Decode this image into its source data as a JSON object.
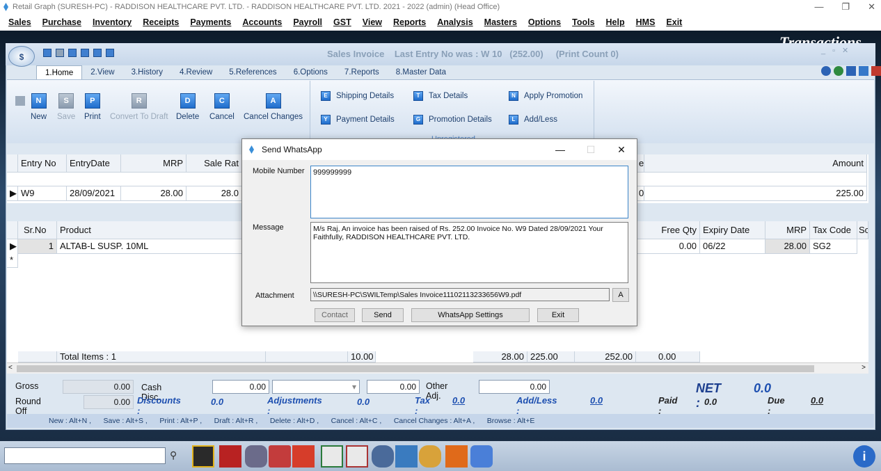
{
  "titlebar": {
    "text": "Retail Graph (SURESH-PC) - RADDISON HEALTHCARE PVT. LTD. - RADDISON HEALTHCARE PVT. LTD. 2021 - 2022 (admin) (Head Office)"
  },
  "menu": [
    "Sales",
    "Purchase",
    "Inventory",
    "Receipts",
    "Payments",
    "Accounts",
    "Payroll",
    "GST",
    "View",
    "Reports",
    "Analysis",
    "Masters",
    "Options",
    "Tools",
    "Help",
    "HMS",
    "Exit"
  ],
  "background": {
    "banner": "Transactions"
  },
  "form": {
    "title": "Sales Invoice    Last Entry No was : W 10   (252.00)     (Print Count 0)",
    "tabs": [
      "1.Home",
      "2.View",
      "3.History",
      "4.Review",
      "5.References",
      "6.Options",
      "7.Reports",
      "8.Master Data"
    ],
    "buttons": {
      "new": "New",
      "save": "Save",
      "print": "Print",
      "draft": "Convert To Draft",
      "delete": "Delete",
      "cancel": "Cancel",
      "cancel_changes": "Cancel Changes"
    },
    "side_buttons": {
      "shipping": "Shipping Details",
      "payment": "Payment Details",
      "tax": "Tax Details",
      "promotion": "Promotion Details",
      "apply_promo": "Apply Promotion",
      "addless": "Add/Less"
    },
    "unregistered": "Unregistered",
    "header_grid": {
      "columns": [
        "Entry No",
        "EntryDate",
        "MRP",
        "Sale Rat",
        "e",
        "Amount"
      ],
      "row": [
        "W9",
        "28/09/2021",
        "28.00",
        "28.0",
        "0",
        "225.00"
      ]
    },
    "items_grid": {
      "columns": [
        "Sr.No",
        "Product",
        "Free Qty",
        "Expiry Date",
        "MRP",
        "Tax Code",
        "Sc"
      ],
      "row": [
        "1",
        "ALTAB-L SUSP. 10ML",
        "0.00",
        "06/22",
        "28.00",
        "SG2"
      ],
      "new_row_marker": "*",
      "totals": {
        "label": "Total Items : 1",
        "qty": "10.00",
        "rate": "28.00",
        "amount": "225.00",
        "net": "252.00",
        "free": "0.00"
      }
    },
    "summary": {
      "gross_label": "Gross",
      "gross": "0.00",
      "cash_disc_label": "Cash Disc.",
      "cash_disc": "0.00",
      "disc_pct": "0.00",
      "other_adj_label": "Other Adj.",
      "other_adj": "0.00",
      "net_label": "NET :",
      "net": "0.0",
      "roundoff_label": "Round Off",
      "roundoff": "0.00",
      "discounts_label": "Discounts :",
      "discounts": "0.0",
      "adjustments_label": "Adjustments :",
      "adjustments": "0.0",
      "tax_label": "Tax :",
      "tax": "0.0",
      "addless_label": "Add/Less :",
      "addless": "0.0",
      "paid_label": "Paid :",
      "paid": "0.0",
      "due_label": "Due :",
      "due": "0.0"
    },
    "shortcuts": "New : Alt+N ,      Save : Alt+S ,      Print : Alt+P ,      Draft : Alt+R ,      Delete : Alt+D ,      Cancel : Alt+C ,      Cancel Changes : Alt+A ,      Browse : Alt+E"
  },
  "dialog": {
    "title": "Send WhatsApp",
    "mobile_label": "Mobile Number",
    "mobile": "999999999",
    "message_label": "Message",
    "message": "M/s Raj, An invoice has been raised of Rs. 252.00 Invoice No. W9 Dated 28/09/2021 Your Faithfully, RADDISON HEALTHCARE PVT. LTD.",
    "attachment_label": "Attachment",
    "attachment": "\\\\SURESH-PC\\SWILTemp\\Sales Invoice11102113233656W9.pdf",
    "attach_btn": "A",
    "contact": "Contact",
    "send": "Send",
    "settings": "WhatsApp Settings",
    "exit": "Exit"
  },
  "colors": {
    "accent": "#1f6dcc",
    "net": "#1d4fb0"
  }
}
